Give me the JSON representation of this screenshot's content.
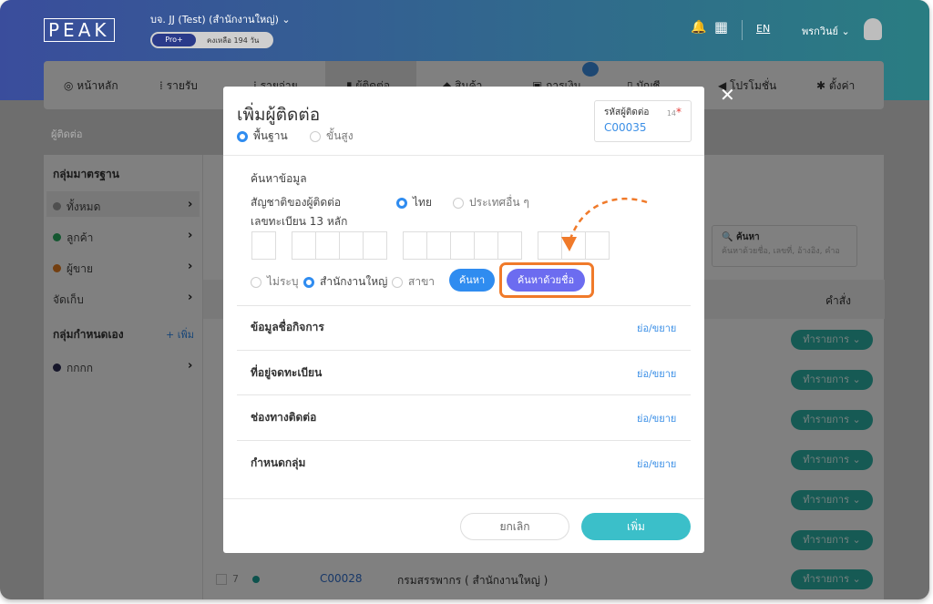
{
  "header": {
    "logo": "PEAK",
    "company": "บจ. JJ (Test) (สำนักงานใหญ่)",
    "plan": "Pro+",
    "remaining": "คงเหลือ 194 วัน",
    "lang": "EN",
    "user": "พรกวินย์"
  },
  "nav": [
    {
      "label": "หน้าหลัก",
      "icon": "home-icon"
    },
    {
      "label": "รายรับ",
      "icon": "income-icon"
    },
    {
      "label": "รายจ่าย",
      "icon": "expense-icon"
    },
    {
      "label": "ผู้ติดต่อ",
      "icon": "contact-icon",
      "active": true
    },
    {
      "label": "สินค้า",
      "icon": "box-icon"
    },
    {
      "label": "การเงิน",
      "icon": "money-icon",
      "badge": "new"
    },
    {
      "label": "บัญชี",
      "icon": "book-icon"
    },
    {
      "label": "โปรโมชั่น",
      "icon": "megaphone-icon"
    },
    {
      "label": "ตั้งค่า",
      "icon": "gear-icon"
    }
  ],
  "breadcrumb": "ผู้ติดต่อ",
  "sidebar": {
    "standard_title": "กลุ่มมาตรฐาน",
    "items": [
      {
        "label": "ทั้งหมด",
        "color": "#9e9e9e"
      },
      {
        "label": "ลูกค้า",
        "color": "#27ae60"
      },
      {
        "label": "ผู้ขาย",
        "color": "#e67e22"
      },
      {
        "label": "จัดเก็บ"
      }
    ],
    "custom_title": "กลุ่มกำหนดเอง",
    "add_label": "+ เพิ่ม",
    "custom_items": [
      {
        "label": "กกกก",
        "color": "#2c2c54"
      }
    ]
  },
  "table": {
    "search_label": "ค้นหา",
    "search_placeholder": "ค้นหาด้วยชื่อ, เลขที่, อ้างอิง, คำอ",
    "command_header": "คำสั่ง",
    "action_label": "ทำรายการ",
    "visible_row": {
      "no": "7",
      "code": "C00028",
      "name": "กรมสรรพากร ( สำนักงานใหญ่ )"
    }
  },
  "modal": {
    "title": "เพิ่มผู้ติดต่อ",
    "mode_basic": "พื้นฐาน",
    "mode_advanced": "ขั้นสูง",
    "code_label": "รหัสผู้ติดต่อ",
    "code_count": "14",
    "code_value": "C00035",
    "search_section": "ค้นหาข้อมูล",
    "nationality_label": "สัญชาติของผู้ติดต่อ",
    "nat_thai": "ไทย",
    "nat_other": "ประเทศอื่น ๆ",
    "tax_label": "เลขทะเบียน 13 หลัก",
    "branch_none": "ไม่ระบุ",
    "branch_hq": "สำนักงานใหญ่",
    "branch_sub": "สาขา",
    "search_btn": "ค้นหา",
    "search_name_btn": "ค้นหาด้วยชื่อ",
    "sections": [
      "ข้อมูลชื่อกิจการ",
      "ที่อยู่จดทะเบียน",
      "ช่องทางติดต่อ",
      "กำหนดกลุ่ม"
    ],
    "toggle_label": "ย่อ/ขยาย",
    "cancel": "ยกเลิก",
    "add": "เพิ่ม"
  },
  "colors": {
    "accent": "#2f8cf0",
    "teal": "#3bbfc9",
    "purple": "#6c6cf0",
    "highlight": "#f07a2a"
  }
}
